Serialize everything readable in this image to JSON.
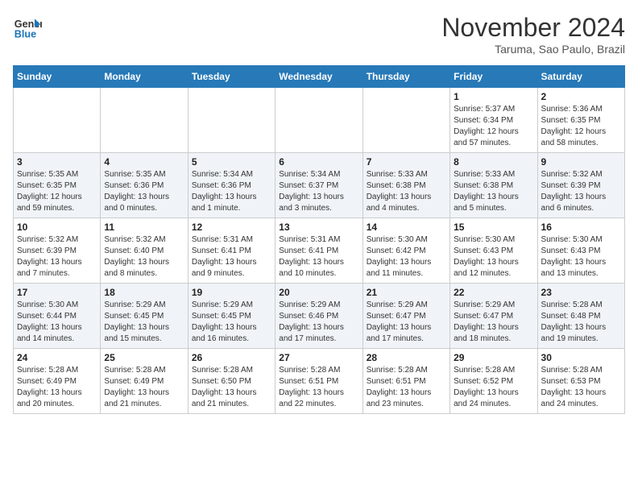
{
  "header": {
    "logo_line1": "General",
    "logo_line2": "Blue",
    "month_title": "November 2024",
    "subtitle": "Taruma, Sao Paulo, Brazil"
  },
  "days_of_week": [
    "Sunday",
    "Monday",
    "Tuesday",
    "Wednesday",
    "Thursday",
    "Friday",
    "Saturday"
  ],
  "weeks": [
    [
      {
        "day": "",
        "info": ""
      },
      {
        "day": "",
        "info": ""
      },
      {
        "day": "",
        "info": ""
      },
      {
        "day": "",
        "info": ""
      },
      {
        "day": "",
        "info": ""
      },
      {
        "day": "1",
        "info": "Sunrise: 5:37 AM\nSunset: 6:34 PM\nDaylight: 12 hours and 57 minutes."
      },
      {
        "day": "2",
        "info": "Sunrise: 5:36 AM\nSunset: 6:35 PM\nDaylight: 12 hours and 58 minutes."
      }
    ],
    [
      {
        "day": "3",
        "info": "Sunrise: 5:35 AM\nSunset: 6:35 PM\nDaylight: 12 hours and 59 minutes."
      },
      {
        "day": "4",
        "info": "Sunrise: 5:35 AM\nSunset: 6:36 PM\nDaylight: 13 hours and 0 minutes."
      },
      {
        "day": "5",
        "info": "Sunrise: 5:34 AM\nSunset: 6:36 PM\nDaylight: 13 hours and 1 minute."
      },
      {
        "day": "6",
        "info": "Sunrise: 5:34 AM\nSunset: 6:37 PM\nDaylight: 13 hours and 3 minutes."
      },
      {
        "day": "7",
        "info": "Sunrise: 5:33 AM\nSunset: 6:38 PM\nDaylight: 13 hours and 4 minutes."
      },
      {
        "day": "8",
        "info": "Sunrise: 5:33 AM\nSunset: 6:38 PM\nDaylight: 13 hours and 5 minutes."
      },
      {
        "day": "9",
        "info": "Sunrise: 5:32 AM\nSunset: 6:39 PM\nDaylight: 13 hours and 6 minutes."
      }
    ],
    [
      {
        "day": "10",
        "info": "Sunrise: 5:32 AM\nSunset: 6:39 PM\nDaylight: 13 hours and 7 minutes."
      },
      {
        "day": "11",
        "info": "Sunrise: 5:32 AM\nSunset: 6:40 PM\nDaylight: 13 hours and 8 minutes."
      },
      {
        "day": "12",
        "info": "Sunrise: 5:31 AM\nSunset: 6:41 PM\nDaylight: 13 hours and 9 minutes."
      },
      {
        "day": "13",
        "info": "Sunrise: 5:31 AM\nSunset: 6:41 PM\nDaylight: 13 hours and 10 minutes."
      },
      {
        "day": "14",
        "info": "Sunrise: 5:30 AM\nSunset: 6:42 PM\nDaylight: 13 hours and 11 minutes."
      },
      {
        "day": "15",
        "info": "Sunrise: 5:30 AM\nSunset: 6:43 PM\nDaylight: 13 hours and 12 minutes."
      },
      {
        "day": "16",
        "info": "Sunrise: 5:30 AM\nSunset: 6:43 PM\nDaylight: 13 hours and 13 minutes."
      }
    ],
    [
      {
        "day": "17",
        "info": "Sunrise: 5:30 AM\nSunset: 6:44 PM\nDaylight: 13 hours and 14 minutes."
      },
      {
        "day": "18",
        "info": "Sunrise: 5:29 AM\nSunset: 6:45 PM\nDaylight: 13 hours and 15 minutes."
      },
      {
        "day": "19",
        "info": "Sunrise: 5:29 AM\nSunset: 6:45 PM\nDaylight: 13 hours and 16 minutes."
      },
      {
        "day": "20",
        "info": "Sunrise: 5:29 AM\nSunset: 6:46 PM\nDaylight: 13 hours and 17 minutes."
      },
      {
        "day": "21",
        "info": "Sunrise: 5:29 AM\nSunset: 6:47 PM\nDaylight: 13 hours and 17 minutes."
      },
      {
        "day": "22",
        "info": "Sunrise: 5:29 AM\nSunset: 6:47 PM\nDaylight: 13 hours and 18 minutes."
      },
      {
        "day": "23",
        "info": "Sunrise: 5:28 AM\nSunset: 6:48 PM\nDaylight: 13 hours and 19 minutes."
      }
    ],
    [
      {
        "day": "24",
        "info": "Sunrise: 5:28 AM\nSunset: 6:49 PM\nDaylight: 13 hours and 20 minutes."
      },
      {
        "day": "25",
        "info": "Sunrise: 5:28 AM\nSunset: 6:49 PM\nDaylight: 13 hours and 21 minutes."
      },
      {
        "day": "26",
        "info": "Sunrise: 5:28 AM\nSunset: 6:50 PM\nDaylight: 13 hours and 21 minutes."
      },
      {
        "day": "27",
        "info": "Sunrise: 5:28 AM\nSunset: 6:51 PM\nDaylight: 13 hours and 22 minutes."
      },
      {
        "day": "28",
        "info": "Sunrise: 5:28 AM\nSunset: 6:51 PM\nDaylight: 13 hours and 23 minutes."
      },
      {
        "day": "29",
        "info": "Sunrise: 5:28 AM\nSunset: 6:52 PM\nDaylight: 13 hours and 24 minutes."
      },
      {
        "day": "30",
        "info": "Sunrise: 5:28 AM\nSunset: 6:53 PM\nDaylight: 13 hours and 24 minutes."
      }
    ]
  ]
}
